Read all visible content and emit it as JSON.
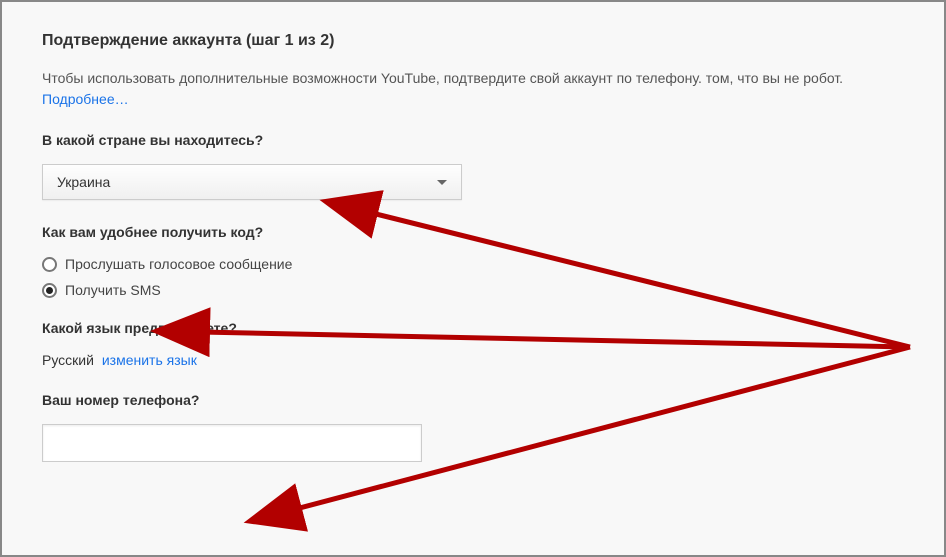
{
  "heading": "Подтверждение аккаунта (шаг 1 из 2)",
  "description_part1": "Чтобы использовать дополнительные возможности YouTube, подтвердите свой аккаунт по телефону. том, что вы не робот. ",
  "learn_more": "Подробнее…",
  "country_question": "В какой стране вы находитесь?",
  "country_selected": "Украина",
  "method_question": "Как вам удобнее получить код?",
  "method_voice": "Прослушать голосовое сообщение",
  "method_sms": "Получить SMS",
  "lang_question": "Какой язык предпочитаете?",
  "lang_current": "Русский",
  "lang_change": "изменить язык",
  "phone_question": "Ваш номер телефона?",
  "phone_value": "",
  "colors": {
    "arrow": "#b20000",
    "link": "#1a73e8"
  }
}
